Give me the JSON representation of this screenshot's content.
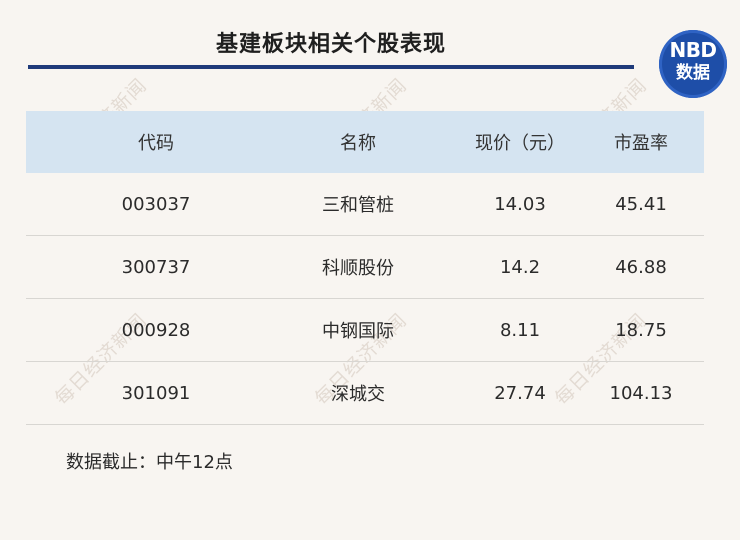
{
  "header": {
    "title": "基建板块相关个股表现"
  },
  "badge": {
    "top_text": "NBD",
    "bottom_text": "数据",
    "color": "#1e4ea8"
  },
  "table": {
    "columns": [
      "代码",
      "名称",
      "现价（元）",
      "市盈率"
    ],
    "rows": [
      {
        "code": "003037",
        "name": "三和管桩",
        "price": "14.03",
        "pe": "45.41"
      },
      {
        "code": "300737",
        "name": "科顺股份",
        "price": "14.2",
        "pe": "46.88"
      },
      {
        "code": "000928",
        "name": "中钢国际",
        "price": "8.11",
        "pe": "18.75"
      },
      {
        "code": "301091",
        "name": "深城交",
        "price": "27.74",
        "pe": "104.13"
      }
    ]
  },
  "footnote": "数据截止：中午12点",
  "watermark": "每日经济新闻",
  "colors": {
    "background": "#f8f5f1",
    "header_row": "#d5e4f1",
    "title_rule": "#1f3a7a"
  }
}
